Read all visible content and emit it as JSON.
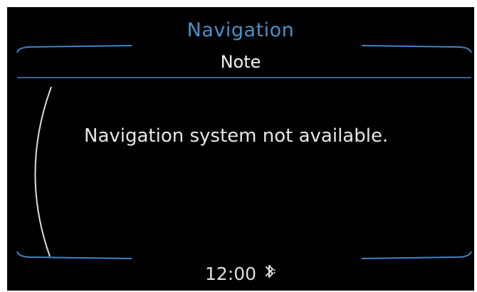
{
  "header": {
    "title": "Navigation",
    "subtitle": "Note"
  },
  "message": {
    "text": "Navigation system not available."
  },
  "status_bar": {
    "time": "12:00",
    "bluetooth_icon": "bluetooth-icon"
  },
  "colors": {
    "background": "#000000",
    "accent": "#4a90c8",
    "text": "#e6e6e6"
  }
}
